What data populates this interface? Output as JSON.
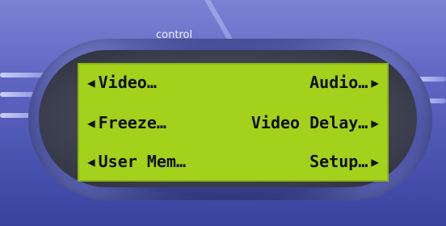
{
  "header": {
    "label": "control"
  },
  "menu": {
    "rows": [
      {
        "left": "Video…",
        "right": "Audio…"
      },
      {
        "left": "Freeze…",
        "right": "Video Delay…"
      },
      {
        "left": "User Mem…",
        "right": "Setup…"
      }
    ],
    "left_arrow": "◀",
    "right_arrow": "▶"
  },
  "colors": {
    "lcd_background": "#a4d11b",
    "panel_blue": "#5f66c2",
    "text": "#111111"
  }
}
